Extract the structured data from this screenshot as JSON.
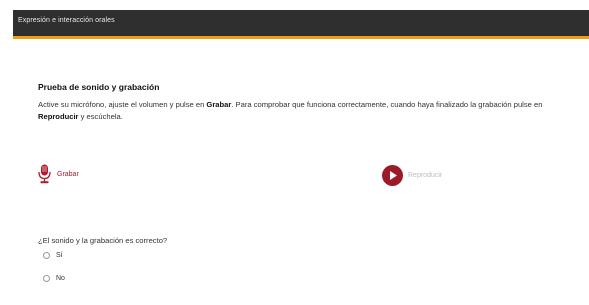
{
  "header": {
    "title": "Expresión e interacción orales"
  },
  "section": {
    "title": "Prueba de sonido y grabación",
    "instructions": {
      "part1": "Active su micrófono, ajuste el volumen y pulse en ",
      "bold1": "Grabar",
      "part2": ". Para comprobar que funciona correctamente, cuando haya finalizado la grabación pulse en ",
      "bold2": "Reproducir",
      "part3": " y escúchela."
    }
  },
  "controls": {
    "record_label": "Grabar",
    "record_icon": "microphone-icon",
    "play_label": "Reproducir",
    "play_icon": "play-icon",
    "record_color": "#b5172b",
    "play_disabled_color": "#bdbdbd"
  },
  "question": {
    "text": "¿El sonido y la grabación es correcto?",
    "options": [
      {
        "label": "Sí"
      },
      {
        "label": "No"
      }
    ]
  },
  "colors": {
    "topbar": "#2f2f2f",
    "accent": "#f39c12"
  }
}
